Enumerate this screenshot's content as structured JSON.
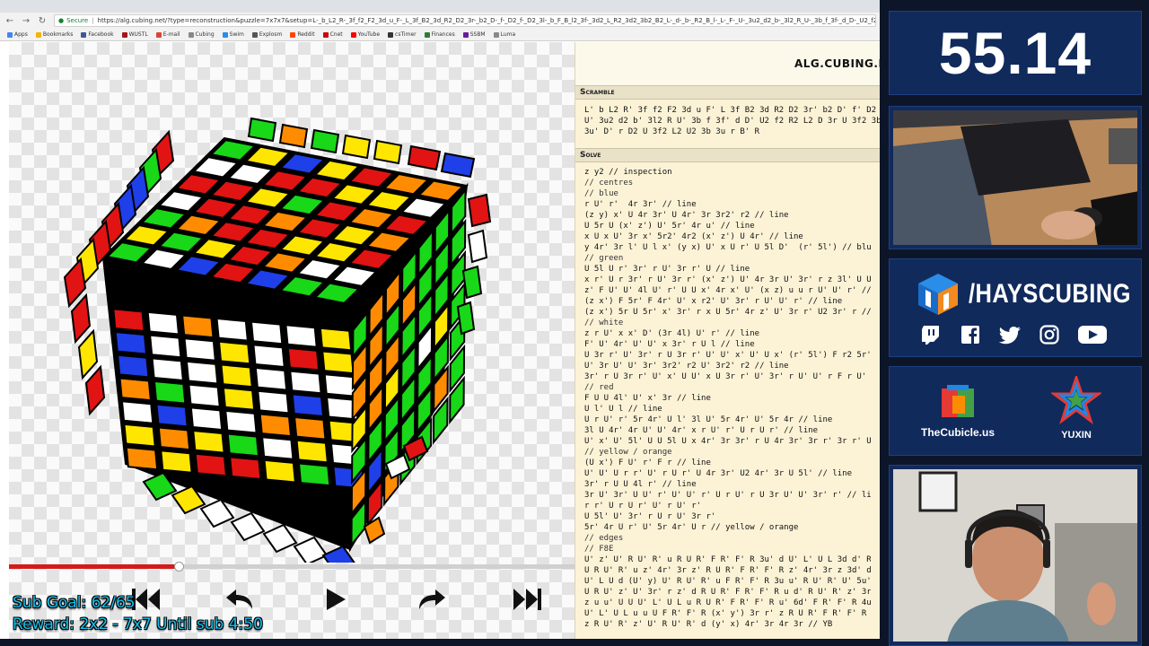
{
  "browser": {
    "secure_label": "Secure",
    "url": "https://alg.cubing.net/?type=reconstruction&puzzle=7x7x7&setup=L-_b_L2_R-_3f_f2_F2_3d_u_F-_L_3f_B2_3d_R2_D2_3r-_b2_D-_f-_D2_f-_D2_3l-_b_F_B_l2_3f-_3d2_L_R2_3d2_3b2_B2_L-_d-_b-_R2_B_l-_L-_F-_U-_3u2_d2_b-_3l2_R_U-_3b_f_3f-_d_D-_U2_f2_R2_L2_D_3r_U_3f2_3b_3r-_d_b-_R2_f",
    "bookmarks": [
      "Apps",
      "Bookmarks",
      "Facebook",
      "WUSTL",
      "E-mail",
      "Cubing",
      "Swim",
      "Explosm",
      "Reddit",
      "Cnet",
      "YouTube",
      "csTimer",
      "Finances",
      "SSBM",
      "Luma"
    ]
  },
  "player": {
    "progress_fraction": 0.3
  },
  "sidebar": {
    "site_title": "ALG.CUBING.NET",
    "scramble_heading": "Scramble",
    "scramble_lines": [
      "L' b L2 R' 3f f2 F2 3d u F' L 3f B2 3d R2 D2 3r' b2 D' f' D2 f' D2 3",
      "U' 3u2 d2 b' 3l2 R U' 3b f 3f' d D' U2 f2 R2 L2 D 3r U 3f2 3b 3r' d",
      "3u' D' r D2 U 3f2 L2 U2 3b 3u r B' R"
    ],
    "solve_heading": "Solve",
    "solve_lines": [
      "z y2 // inspection",
      "// centres",
      "// blue",
      "r U' r'  4r 3r' // line",
      "(z y) x' U 4r 3r' U 4r' 3r 3r2' r2 // line",
      "U 5r U (x' z') U' 5r' 4r u' // line",
      "x U x U' 3r x' 5r2' 4r2 (x' z') U 4r' // line",
      "y 4r' 3r l' U l x' (y x) U' x U r' U 5l D'  (r' 5l') // blue",
      "// green",
      "U 5l U r' 3r' r U' 3r r' U // line",
      "x r' U r 3r' r U' 3r r' (x' z') U' 4r 3r U' 3r' r z 3l' U U 3l // line",
      "z' F U' U' 4l U' r' U U x' 4r x' U' (x z) u u r U' U' r' // line",
      "(z x') F 5r' F 4r' U' x r2' U' 3r' r U' U' r' // line",
      "(z x') 5r U 5r' x' 3r' r x U 5r' 4r z' U' 3r r' U2 3r' r // green",
      "// white",
      "z r U' x x' D' (3r 4l) U' r' // line",
      "F' U' 4r' U' U' x 3r' r U l // line",
      "U 3r r' U' 3r' r U 3r r' U' U' x' U' U x' (r' 5l') F r2 5r' 4r // line",
      "U' 3r U' U' 3r' 3r2' r2 U' 3r2' r2 // line",
      "3r' r U 3r r' U' x' U U' x U 3r r' U' 3r' r U' U' r F r U' r2' // white",
      "// red",
      "F U U 4l' U' x' 3r // line",
      "U l' U l // line",
      "U r U' r' 5r 4r' U l' 3l U' 5r 4r' U' 5r 4r // line",
      "3l U 4r' 4r U' U' 4r' x r U' r' U r U r' // line",
      "U' x' U' 5l' U U 5l U x 4r' 3r 3r' r U 4r 3r' 3r r' 3r r' U2 3r' r // red",
      "// yellow / orange",
      "(U x') F U' r' F r // line",
      "U' U' U r r' U' r U r' U 4r 3r' U2 4r' 3r U 5l' // line",
      "3r' r U U 4l r' // line",
      "3r U' 3r' U U' r' U' U' r' U r U' r U 3r U' U' 3r' r' // line",
      "r r' U r U r' U' r U' r'",
      "U 5l' U' 3r' r U r U' 3r r'",
      "5r' 4r U r' U' 5r 4r' U r // yellow / orange",
      "// edges",
      "// F8E",
      "U' z' U' R U' R' u R U R' F R' F' R 3u' d U' L' U L 3d d' R U R' F R'",
      "U R U' R' u z' 4r' 3r z' R U R' F R' F' R z' 4r' 3r z 3d' d F R' F' R u",
      "U' L U d (U' y) U' R U' R' u F R' F' R 3u u' R U' R' U' 5u' // WB",
      "U R U' z' U' 3r' r z' d R U R' F R' F' R u d' R U' R' z' 3r' r // WO",
      "z u u' U U U' L' U L u R U R' F R' F' R u' 6d' F R' F' R 4u' U y R U' R'",
      "U' L' U L u u U F R' F' R (x' y') 3r r' z R U R' F R' F' R u F R' R R' F",
      "z R U' R' z' U' R U' R' d (y' x) 4r' 3r 4r 3r // YB"
    ]
  },
  "overlay": {
    "timer": "55.14",
    "channel": "/HAYSCUBING",
    "socials": [
      "twitch-icon",
      "facebook-icon",
      "twitter-icon",
      "instagram-icon",
      "youtube-icon"
    ],
    "sponsor_left": "TheCubicle.us",
    "sponsor_right": "YUXIN"
  },
  "goal": {
    "line1": "Sub Goal: 62/65",
    "line2": "Reward: 2x2 - 7x7 Until sub 4:50"
  },
  "colors": {
    "accent_blue": "#112a5c",
    "goal_cyan": "#19c0ee",
    "progress_red": "#d41a1a"
  },
  "cube": {
    "top": [
      "GYBYROO",
      "WWRRYYW",
      "RRYGROR",
      "WRRORYO",
      "GORRYYR",
      "YGYROWW",
      "GWBRBGG"
    ],
    "front": [
      "RWOWWWY",
      "BWWYWRY",
      "BWWYWWW",
      "OGWYWBW",
      "WBWWOOY",
      "YOYGWYW",
      "OYRRYGB"
    ],
    "right": [
      "GOOGGGG",
      "OOGOGGG",
      "OOOGGGG",
      "YOYGWYG",
      "GGGGGGG",
      "OBGGGOG",
      "GROGGGG"
    ]
  }
}
